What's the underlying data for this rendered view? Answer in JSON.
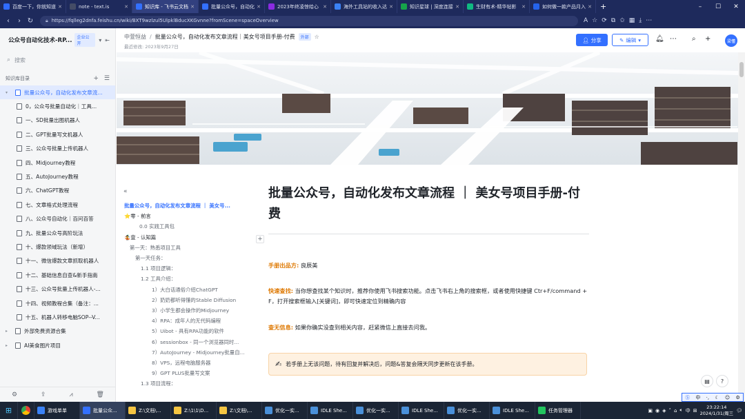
{
  "browser": {
    "tabs": [
      {
        "title": "百度一下，你就知道",
        "color": "#2f6bff"
      },
      {
        "title": "note - text.is",
        "color": "#444c66"
      },
      {
        "title": "知识库 - 飞书云文档",
        "color": "#3370ff",
        "active": true
      },
      {
        "title": "批量公众号，自动化",
        "color": "#3370ff"
      },
      {
        "title": "2023年终凌惊给心",
        "color": "#8a2be2"
      },
      {
        "title": "海外工具站的收入达",
        "color": "#3b82f6"
      },
      {
        "title": "知识星球 | 深度连接",
        "color": "#16a34a"
      },
      {
        "title": "生财有术-精华帖影",
        "color": "#10b981"
      },
      {
        "title": "如何做一款产品月入",
        "color": "#2563eb"
      }
    ],
    "new_tab": "+",
    "url": "https://fqlleg2dnfa.feishu.cn/wiki/BXT9wzlzul5UlpklBducXKGvnne?fromScene=spaceOverview"
  },
  "sidebar": {
    "title": "公众号自动化技术-RP...",
    "badge": "企业公开",
    "search_placeholder": "搜索",
    "section": "知识库目录",
    "items": [
      {
        "label": "批量公众号，自动化发布文章流...",
        "level": 0,
        "active": true,
        "caret": "▾"
      },
      {
        "label": "0，公众号批量自动化｜工具...",
        "level": 1
      },
      {
        "label": "一、SD批量出图机器人",
        "level": 1
      },
      {
        "label": "二、GPT批量写文机器人",
        "level": 1
      },
      {
        "label": "三、公众号批量上传机器人",
        "level": 1
      },
      {
        "label": "四、Midjourney教程",
        "level": 1
      },
      {
        "label": "五、AutoJourney教程",
        "level": 1
      },
      {
        "label": "六、ChatGPT教程",
        "level": 1
      },
      {
        "label": "七、文章格式处理流程",
        "level": 1
      },
      {
        "label": "八、公众号自动化｜百问百答",
        "level": 1
      },
      {
        "label": "九、批量公众号高阶玩法",
        "level": 1
      },
      {
        "label": "十、爆款领域玩法（新增）",
        "level": 1
      },
      {
        "label": "十一、微信爆款文章抓取机器人",
        "level": 1
      },
      {
        "label": "十二、基础信息自查&新手指南",
        "level": 1
      },
      {
        "label": "十三、公众号批量上传机器人-...",
        "level": 1
      },
      {
        "label": "十四、视频教程合集（备注：...",
        "level": 1
      },
      {
        "label": "十五、机器人转移电脑SOP--V...",
        "level": 1
      },
      {
        "label": "外部免费资源合集",
        "level": 0,
        "caret": "▸"
      },
      {
        "label": "AI美食图片项目",
        "level": 0,
        "caret": "▸"
      }
    ]
  },
  "header": {
    "space": "中萱恒益",
    "doc_title": "批量公众号，自动化发布文章流程｜美女号项目手册-付费",
    "external": "外部",
    "modified": "最近修改: 2023年9月27日",
    "share_label": "分享",
    "edit_label": "编辑",
    "avatar_text": "梁懂"
  },
  "outline": {
    "items": [
      {
        "label": "批量公众号，自动化发布文章流程 ｜ 美女号...",
        "indent": 0,
        "cur": true
      },
      {
        "label": "⭐零 - 前言",
        "indent": 0,
        "h1": true
      },
      {
        "label": "0.0 实践工具包",
        "indent": 22
      },
      {
        "label": "🤹壹 - 认知篇",
        "indent": 0,
        "h1": true
      },
      {
        "label": "第一天：熟悉项目工具",
        "indent": 8
      },
      {
        "label": "第一天任务：",
        "indent": 16
      },
      {
        "label": "1.1 项目逻辑：",
        "indent": 24
      },
      {
        "label": "1.2 工具介绍：",
        "indent": 24
      },
      {
        "label": "1）大白话通俗介绍ChatGPT",
        "indent": 40
      },
      {
        "label": "2）奶奶都听得懂的Stable Diffusion",
        "indent": 40
      },
      {
        "label": "3）小学生都会操作的Midjourney",
        "indent": 40
      },
      {
        "label": "4）RPA：成年人的无代码编程",
        "indent": 40
      },
      {
        "label": "5）Uibot - 具有RPA功能的软件",
        "indent": 40
      },
      {
        "label": "6）sessionbox - 同一个浏览器同时...",
        "indent": 40
      },
      {
        "label": "7）AutoJourney - Midjourney批量自...",
        "indent": 40
      },
      {
        "label": "8）VPS，远程电脑服务器",
        "indent": 40
      },
      {
        "label": "9）GPT PLUS批量写文案",
        "indent": 40
      },
      {
        "label": "1.3 项目流程：",
        "indent": 24
      }
    ]
  },
  "content": {
    "title": "批量公众号，自动化发布文章流程 ｜ 美女号项目手册-付费",
    "author_key": "手册出品方:",
    "author_val": "良辰美",
    "search_key": "快速查找:",
    "search_val": "当你想查找某个知识时，推荐你使用飞书搜索功能。点击飞书右上角的搜索框，或者使用快捷键 Ctr+F/command + F，打开搜索框输入[关键词]，即可快速定位到精确内容",
    "nofind_key": "查无信息:",
    "nofind_val": "如果你确实没查到相关内容，赶紧微信上直接去问我。",
    "callout_icon": "✍",
    "callout": "若手册上无该问题，待有回复并解决后，问题&答复会隔天同步更新在该手册。"
  },
  "taskbar": {
    "items": [
      {
        "label": "游戏单单",
        "color": "#3b82f6"
      },
      {
        "label": "批量公众...",
        "color": "#3370ff",
        "active": true
      },
      {
        "label": "Z:\\文档\\...",
        "color": "#f5c542"
      },
      {
        "label": "Z:\\1\\1\\D...",
        "color": "#f5c542"
      },
      {
        "label": "Z:\\文档\\...",
        "color": "#f5c542"
      },
      {
        "label": "优化一实...",
        "color": "#4a90d9"
      },
      {
        "label": "IDLE She...",
        "color": "#4a90d9"
      },
      {
        "label": "优化一实...",
        "color": "#4a90d9"
      },
      {
        "label": "IDLE She...",
        "color": "#4a90d9"
      },
      {
        "label": "优化一实...",
        "color": "#4a90d9"
      },
      {
        "label": "IDLE She...",
        "color": "#4a90d9"
      },
      {
        "label": "任务管理器",
        "color": "#22c55e"
      }
    ],
    "ime": "中",
    "time": "23:22:14",
    "date": "2024/1/31/周三"
  }
}
